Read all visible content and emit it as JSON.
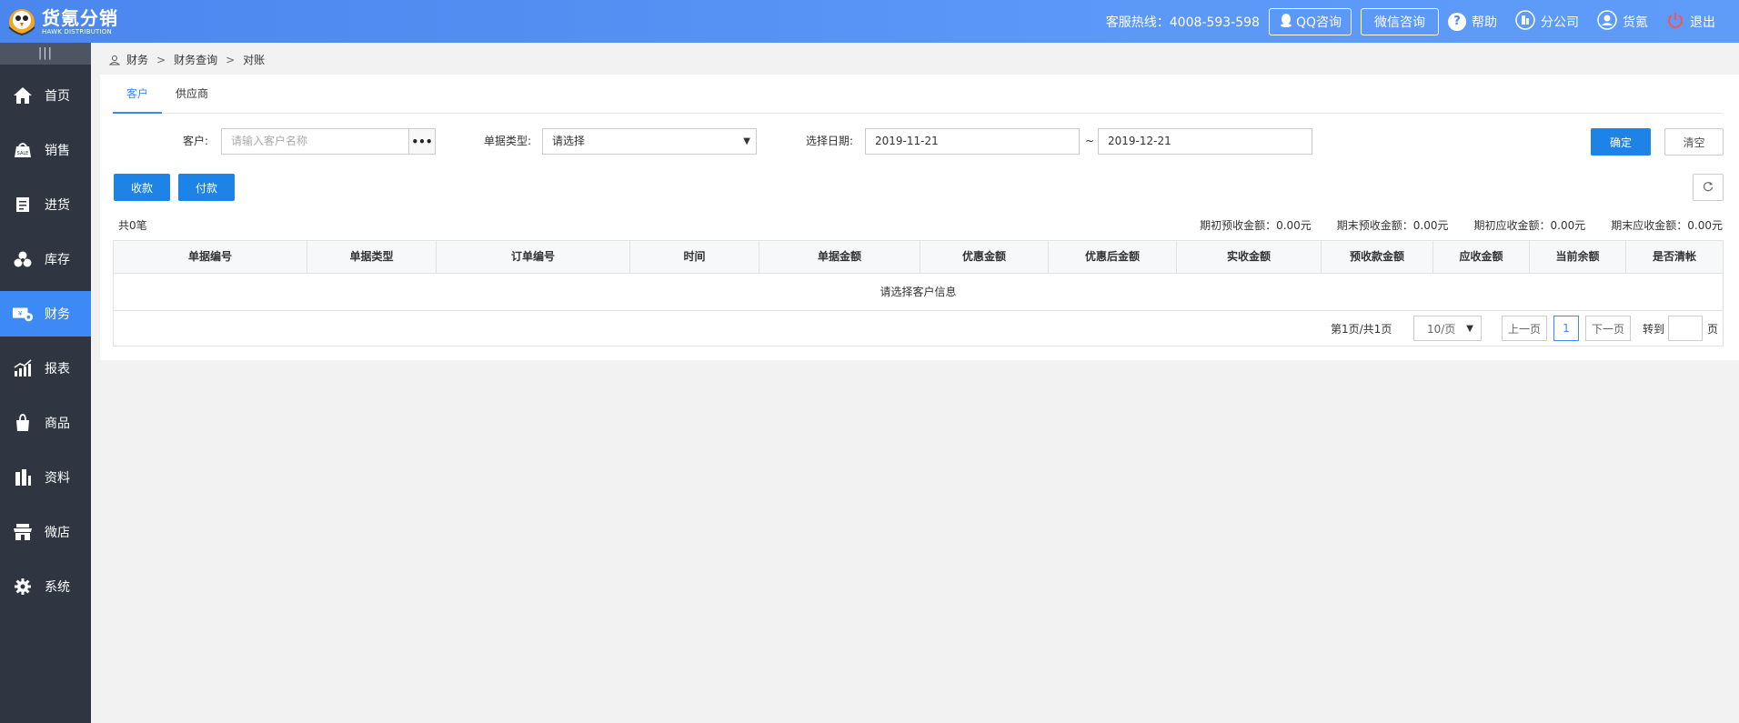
{
  "app": {
    "logo_cn": "货氪分销",
    "logo_en": "HAWK DISTRIBUTION"
  },
  "header": {
    "hotline": "客服热线：4008-593-598",
    "qq_label": "QQ咨询",
    "wechat_label": "微信咨询",
    "help_label": "帮助",
    "branch_label": "分公司",
    "user_label": "货氪",
    "logout_label": "退出"
  },
  "sidebar": {
    "toggle": "|||",
    "items": [
      {
        "label": "首页",
        "icon": "home-icon"
      },
      {
        "label": "销售",
        "icon": "sales-icon"
      },
      {
        "label": "进货",
        "icon": "purchase-icon"
      },
      {
        "label": "库存",
        "icon": "inventory-icon"
      },
      {
        "label": "财务",
        "icon": "finance-icon",
        "active": true
      },
      {
        "label": "报表",
        "icon": "report-icon"
      },
      {
        "label": "商品",
        "icon": "goods-icon"
      },
      {
        "label": "资料",
        "icon": "data-icon"
      },
      {
        "label": "微店",
        "icon": "shop-icon"
      },
      {
        "label": "系统",
        "icon": "settings-icon"
      }
    ]
  },
  "breadcrumb": [
    "财务",
    "财务查询",
    "对账"
  ],
  "tabs": [
    "客户",
    "供应商"
  ],
  "filters": {
    "customer_label": "客户:",
    "customer_placeholder": "请输入客户名称",
    "doc_type_label": "单据类型:",
    "doc_type_value": "请选择",
    "date_label": "选择日期:",
    "date_from": "2019-11-21",
    "date_sep": "~",
    "date_to": "2019-12-21",
    "confirm_label": "确定",
    "clear_label": "清空"
  },
  "actions": {
    "receive_label": "收款",
    "pay_label": "付款"
  },
  "summary": {
    "count": "共0笔",
    "items": [
      "期初预收金额：0.00元",
      "期末预收金额：0.00元",
      "期初应收金额：0.00元",
      "期末应收金额：0.00元"
    ]
  },
  "table": {
    "columns": [
      "单据编号",
      "单据类型",
      "订单编号",
      "时间",
      "单据金额",
      "优惠金额",
      "优惠后金额",
      "实收金额",
      "预收款金额",
      "应收金额",
      "当前余额",
      "是否清帐"
    ],
    "empty_text": "请选择客户信息"
  },
  "pager": {
    "info": "第1页/共1页",
    "page_size": "10/页",
    "prev": "上一页",
    "current": "1",
    "next": "下一页",
    "goto_label": "转到",
    "goto_suffix": "页"
  },
  "colors": {
    "header_blue": "#5b97f6",
    "sidebar_bg": "#2f3641",
    "active_blue": "#3d8af7",
    "button_blue": "#1e83e6"
  }
}
